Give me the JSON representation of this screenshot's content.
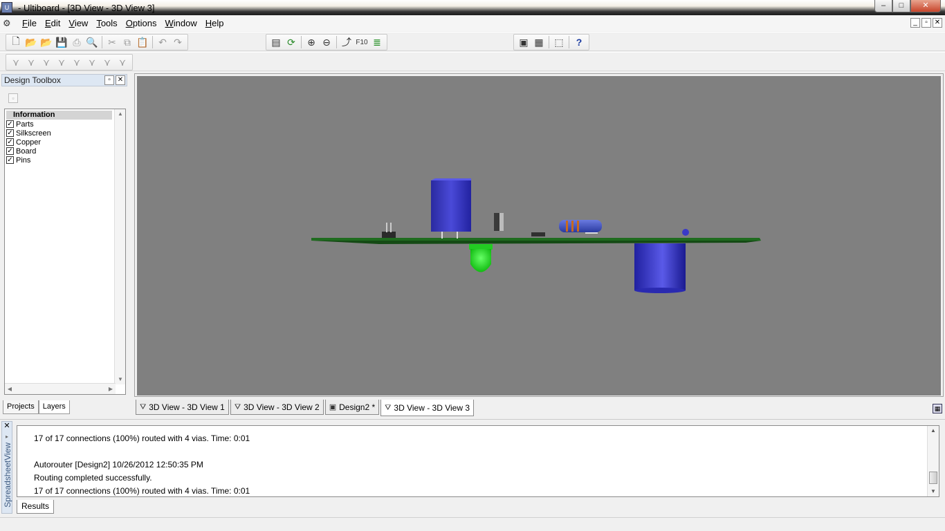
{
  "window": {
    "title": "- Ultiboard - [3D View - 3D View 3]",
    "min_label": "–",
    "max_label": "□",
    "close_label": "✕"
  },
  "menu": {
    "items": [
      "File",
      "Edit",
      "View",
      "Tools",
      "Options",
      "Window",
      "Help"
    ]
  },
  "mdi_controls": [
    "_",
    "▫",
    "✕"
  ],
  "toolbox": {
    "title": "Design Toolbox",
    "pin_label": "▫",
    "close_label": "✕",
    "list_header": "Information",
    "layers": [
      {
        "label": "Parts",
        "checked": "✓"
      },
      {
        "label": "Silkscreen",
        "checked": "✓"
      },
      {
        "label": "Copper",
        "checked": "✓"
      },
      {
        "label": "Board",
        "checked": "✓"
      },
      {
        "label": "Pins",
        "checked": "✓"
      }
    ],
    "tabs": [
      "Projects",
      "Layers"
    ]
  },
  "doc_tabs": [
    {
      "label": "3D View - 3D View 1",
      "icon": "3d-view-icon"
    },
    {
      "label": "3D View - 3D View 2",
      "icon": "3d-view-icon"
    },
    {
      "label": "Design2 *",
      "icon": "chip-icon"
    },
    {
      "label": "3D View - 3D View 3",
      "icon": "3d-view-icon"
    }
  ],
  "results": {
    "side_label": "SpreadsheetView",
    "lines": [
      "17 of 17 connections (100%) routed with 4 vias.  Time: 0:01",
      "Autorouter [Design2]  10/26/2012 12:50:35 PM",
      "Routing completed successfully.",
      "17 of 17 connections (100%) routed with 4 vias.  Time: 0:01"
    ],
    "tab_label": "Results"
  },
  "colors": {
    "viewport_bg": "#808080",
    "board": "#1f6b1f",
    "component_blue": "#3a3ac0",
    "led_green": "#22dd22"
  }
}
